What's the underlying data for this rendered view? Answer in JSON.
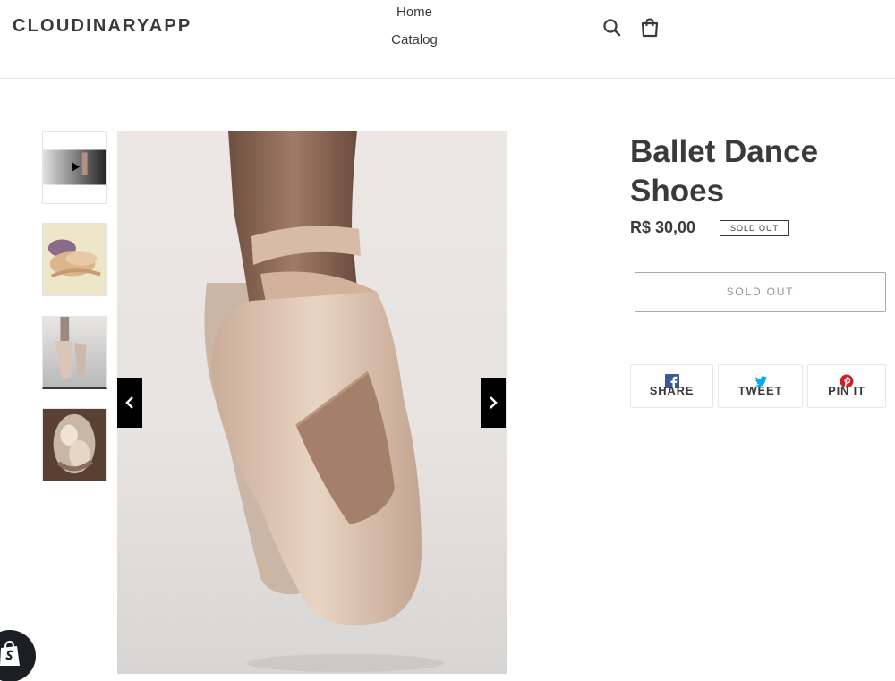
{
  "header": {
    "logo": "CLOUDINARYAPP",
    "nav": [
      {
        "label": "Home"
      },
      {
        "label": "Catalog"
      }
    ],
    "icons": [
      "search-icon",
      "cart-icon"
    ]
  },
  "gallery": {
    "thumbnails": [
      {
        "name": "video-thumbnail",
        "icon": "play-icon"
      },
      {
        "name": "shoes-flatlay-thumbnail"
      },
      {
        "name": "pointe-shoes-thumbnail",
        "active": true
      },
      {
        "name": "dancer-thumbnail"
      }
    ],
    "controls": [
      "chevron-left-icon",
      "chevron-right-icon"
    ]
  },
  "product": {
    "title": "Ballet Dance Shoes",
    "price": "R$ 30,00",
    "badge": "SOLD OUT",
    "button_label": "SOLD OUT"
  },
  "share": [
    {
      "label": "SHARE",
      "icon": "facebook-icon",
      "color": "#3b5998"
    },
    {
      "label": "TWEET",
      "icon": "twitter-icon",
      "color": "#00aced"
    },
    {
      "label": "PIN IT",
      "icon": "pinterest-icon",
      "color": "#cb2027"
    }
  ],
  "colors": {
    "text": "#3a3a3a",
    "border": "#e8e8e1",
    "button_disabled_text": "#949494"
  }
}
